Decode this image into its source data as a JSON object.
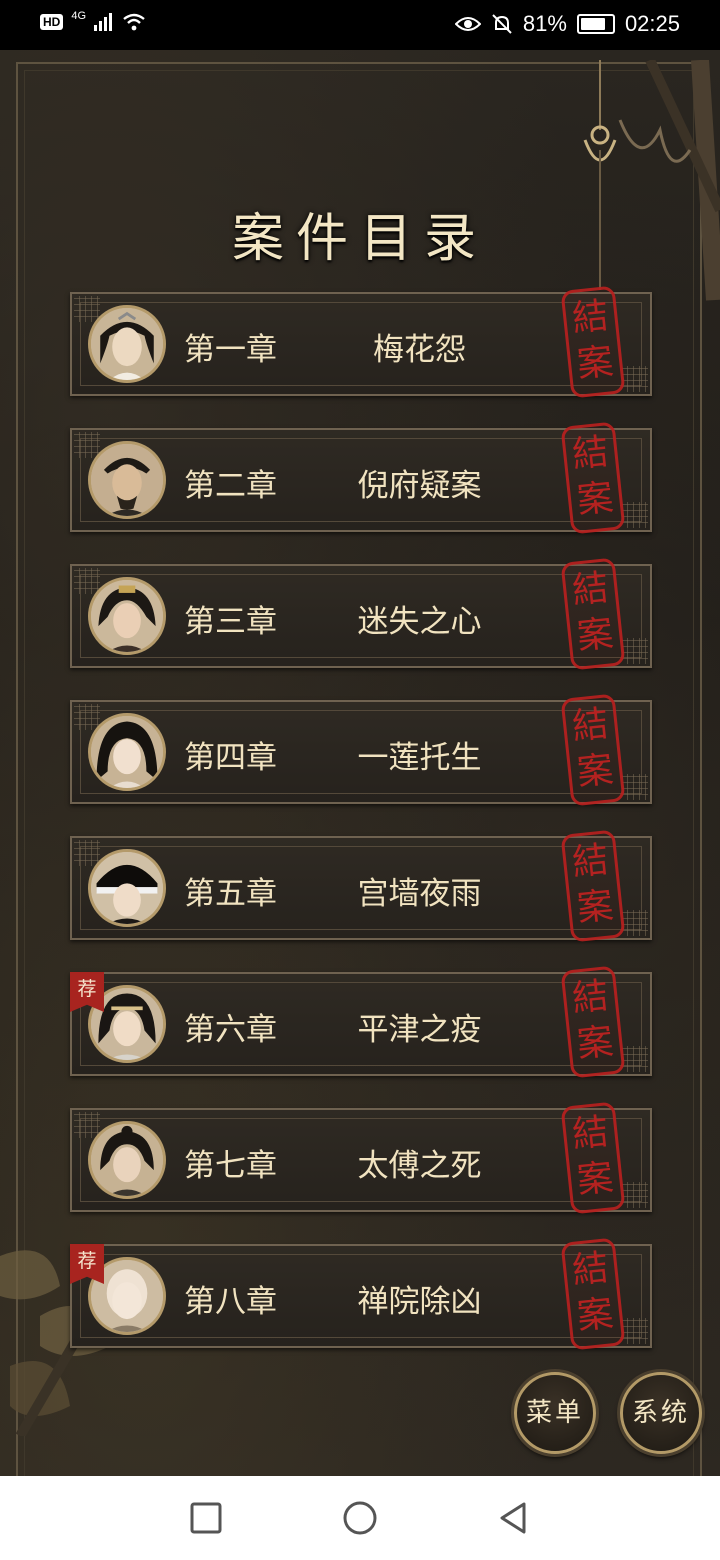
{
  "status_bar": {
    "hd": "HD",
    "network": "4G",
    "battery_percent": "81%",
    "time": "02:25"
  },
  "title": "案件目录",
  "chapters": [
    {
      "label": "第一章",
      "name": "梅花怨",
      "stamp": "結案",
      "recommended": false
    },
    {
      "label": "第二章",
      "name": "倪府疑案",
      "stamp": "結案",
      "recommended": false
    },
    {
      "label": "第三章",
      "name": "迷失之心",
      "stamp": "結案",
      "recommended": false
    },
    {
      "label": "第四章",
      "name": "一莲托生",
      "stamp": "結案",
      "recommended": false
    },
    {
      "label": "第五章",
      "name": "宫墙夜雨",
      "stamp": "結案",
      "recommended": false
    },
    {
      "label": "第六章",
      "name": "平津之疫",
      "stamp": "結案",
      "recommended": true
    },
    {
      "label": "第七章",
      "name": "太傅之死",
      "stamp": "結案",
      "recommended": false
    },
    {
      "label": "第八章",
      "name": "禅院除凶",
      "stamp": "結案",
      "recommended": true
    }
  ],
  "recommend_badge": "荐",
  "buttons": {
    "menu": "菜单",
    "system": "系统"
  },
  "colors": {
    "stamp_red": "#c02221",
    "gold_text": "#f1e3c0",
    "frame": "#6f6250"
  }
}
